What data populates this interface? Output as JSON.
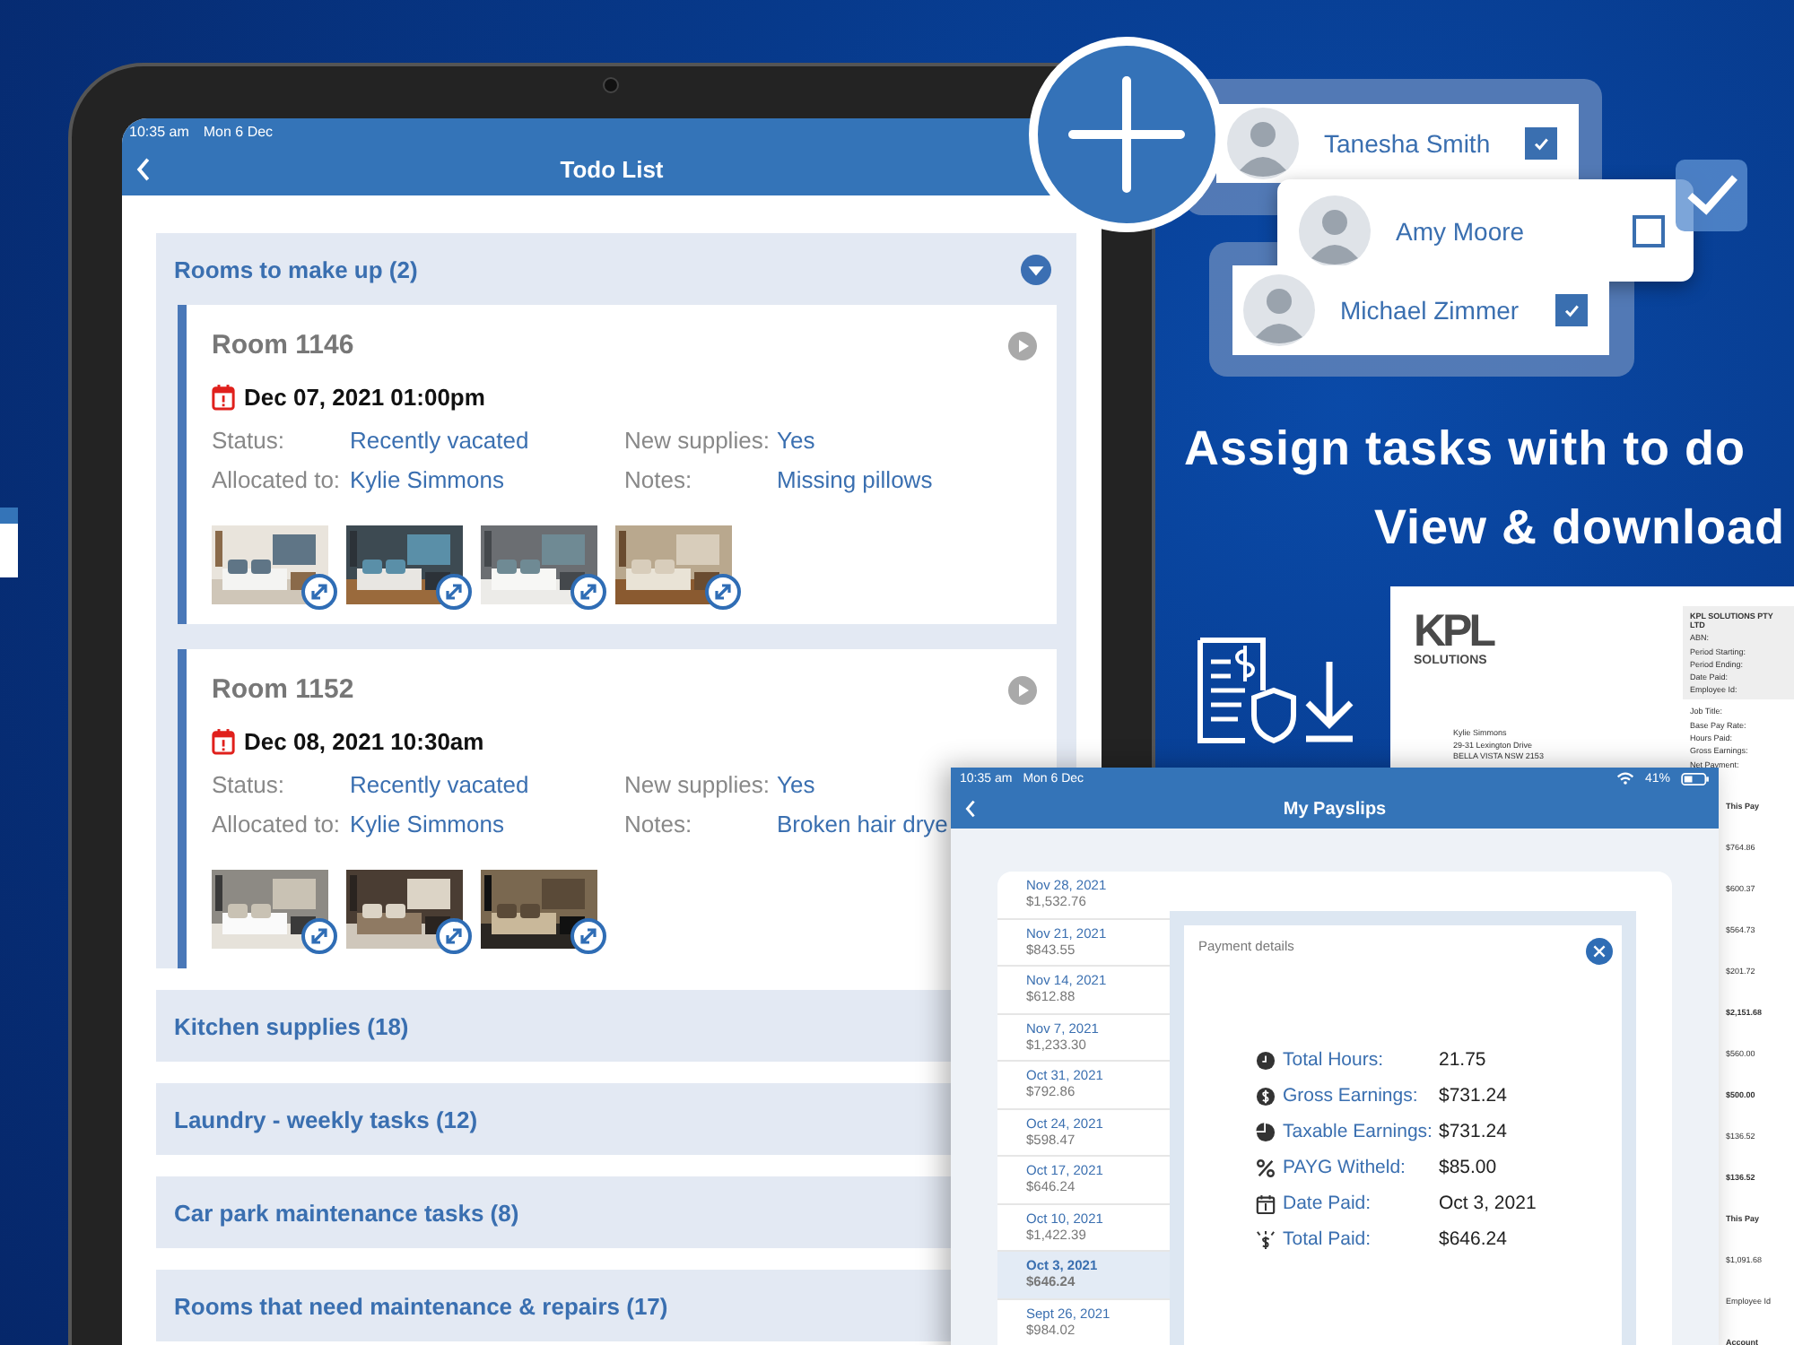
{
  "todo": {
    "status_time": "10:35 am",
    "status_date": "Mon 6 Dec",
    "title": "Todo List",
    "sections": [
      {
        "title": "Rooms to make up (2)",
        "expanded": true,
        "rooms": [
          {
            "name": "Room 1146",
            "date": "Dec 07, 2021 01:00pm",
            "fields": [
              {
                "label": "Status:",
                "value": "Recently vacated"
              },
              {
                "label": "New supplies:",
                "value": "Yes"
              },
              {
                "label": "Allocated to:",
                "value": "Kylie Simmons"
              },
              {
                "label": "Notes:",
                "value": "Missing pillows"
              }
            ],
            "photos": [
              {
                "kind": "picture"
              },
              {
                "kind": "picture"
              },
              {
                "kind": "picture"
              },
              {
                "kind": "picture"
              }
            ]
          },
          {
            "name": "Room 1152",
            "date": "Dec 08, 2021 10:30am",
            "fields": [
              {
                "label": "Status:",
                "value": "Recently vacated"
              },
              {
                "label": "New supplies:",
                "value": "Yes"
              },
              {
                "label": "Allocated to:",
                "value": "Kylie Simmons"
              },
              {
                "label": "Notes:",
                "value": "Broken hair drye"
              }
            ],
            "photos": [
              {
                "kind": "picture"
              },
              {
                "kind": "picture"
              },
              {
                "kind": "picture"
              }
            ]
          }
        ]
      },
      {
        "title": "Kitchen supplies (18)",
        "expanded": false
      },
      {
        "title": "Laundry - weekly tasks (12)",
        "expanded": false
      },
      {
        "title": "Car park maintenance tasks (8)",
        "expanded": false
      },
      {
        "title": "Rooms that need maintenance & repairs (17)",
        "expanded": false
      }
    ]
  },
  "assignees": [
    {
      "name": "Tanesha Smith",
      "checked": true
    },
    {
      "name": "Amy Moore",
      "checked": false
    },
    {
      "name": "Michael Zimmer",
      "checked": true
    }
  ],
  "headline": [
    "Assign tasks with to do",
    "View & download"
  ],
  "document": {
    "logo_top": "KPL",
    "logo_bottom": "SOLUTIONS",
    "company": "KPL SOLUTIONS PTY LTD",
    "info_labels": [
      "ABN:",
      "Period Starting:",
      "Period Ending:",
      "Date Paid:",
      "Employee Id:"
    ],
    "pay_labels": [
      "Job Title:",
      "Base Pay Rate:",
      "Hours Paid:",
      "Gross Earnings:",
      "Net Payment:"
    ],
    "address": [
      "Kylie Simmons",
      "29-31 Lexington Drive",
      "BELLA VISTA NSW 2153"
    ],
    "strip": [
      {
        "kind": "head",
        "text": "This Pay"
      },
      {
        "kind": "value",
        "text": "$764.86"
      },
      {
        "kind": "value",
        "text": "$600.37"
      },
      {
        "kind": "value",
        "text": "$564.73"
      },
      {
        "kind": "value",
        "text": "$201.72"
      },
      {
        "kind": "total",
        "text": "$2,151.68"
      },
      {
        "kind": "value",
        "text": "$560.00"
      },
      {
        "kind": "total",
        "text": "$500.00"
      },
      {
        "kind": "value",
        "text": "$136.52"
      },
      {
        "kind": "total",
        "text": "$136.52"
      },
      {
        "kind": "head",
        "text": "This Pay"
      },
      {
        "kind": "value",
        "text": "$1,091.68"
      },
      {
        "kind": "value",
        "text": "Employee Id"
      },
      {
        "kind": "head",
        "text": "Account"
      }
    ]
  },
  "payslips": {
    "status_time": "10:35 am",
    "status_date": "Mon 6 Dec",
    "battery": "41%",
    "title": "My Payslips",
    "list": [
      {
        "date": "Nov 28, 2021",
        "amount": "$1,532.76",
        "selected": false
      },
      {
        "date": "Nov 21, 2021",
        "amount": "$843.55",
        "selected": false
      },
      {
        "date": "Nov 14, 2021",
        "amount": "$612.88",
        "selected": false
      },
      {
        "date": "Nov 7, 2021",
        "amount": "$1,233.30",
        "selected": false
      },
      {
        "date": "Oct 31, 2021",
        "amount": "$792.86",
        "selected": false
      },
      {
        "date": "Oct 24, 2021",
        "amount": "$598.47",
        "selected": false
      },
      {
        "date": "Oct 17, 2021",
        "amount": "$646.24",
        "selected": false
      },
      {
        "date": "Oct 10, 2021",
        "amount": "$1,422.39",
        "selected": false
      },
      {
        "date": "Oct 3, 2021",
        "amount": "$646.24",
        "selected": true
      },
      {
        "date": "Sept 26, 2021",
        "amount": "$984.02",
        "selected": false
      }
    ],
    "details": {
      "heading": "Payment details",
      "rows": [
        {
          "kind": "clock",
          "label": "Total Hours:",
          "value": "21.75"
        },
        {
          "kind": "dollar",
          "label": "Gross Earnings:",
          "value": "$731.24"
        },
        {
          "kind": "pie",
          "label": "Taxable Earnings:",
          "value": "$731.24"
        },
        {
          "kind": "percent",
          "label": "PAYG Witheld:",
          "value": "$85.00"
        },
        {
          "kind": "calendar",
          "label": "Date Paid:",
          "value": "Oct 3, 2021"
        },
        {
          "kind": "money",
          "label": "Total Paid:",
          "value": "$646.24"
        }
      ]
    }
  }
}
